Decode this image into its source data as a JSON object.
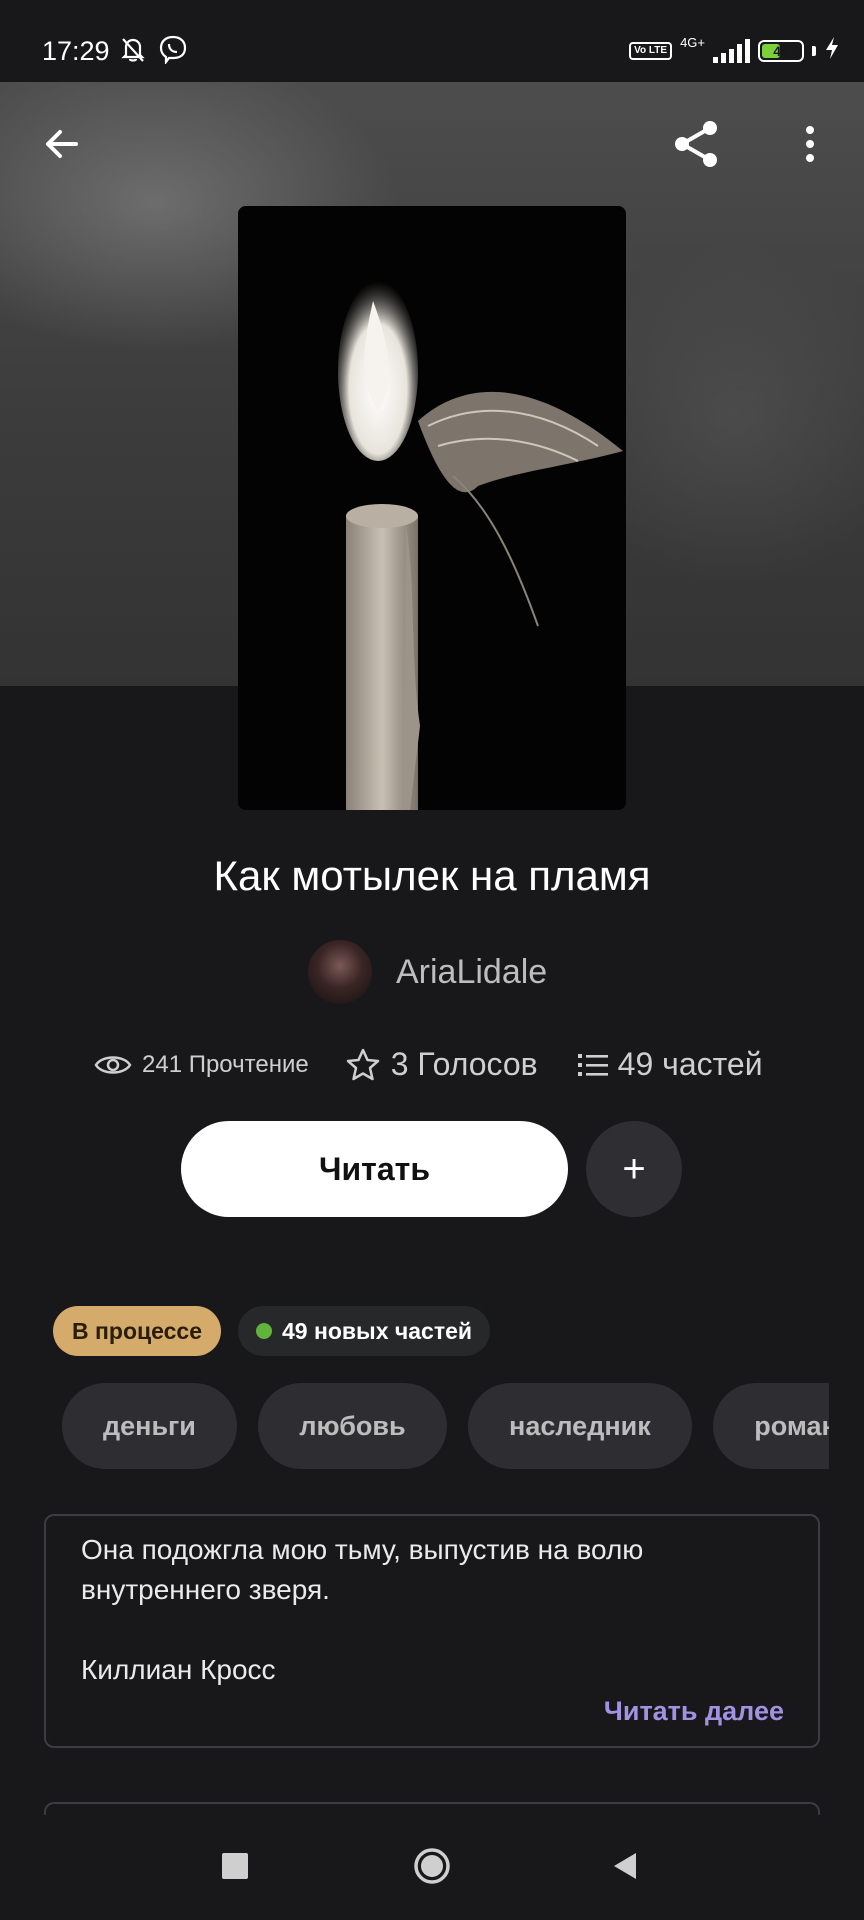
{
  "status_bar": {
    "time": "17:29",
    "network": "4G+",
    "volte": "Vo LTE",
    "battery": "46",
    "icons": [
      "mute-bell-icon",
      "viber-icon",
      "signal-icon",
      "battery-icon",
      "charging-icon"
    ]
  },
  "header": {
    "back_icon": "arrow-left-icon",
    "share_icon": "share-icon",
    "more_icon": "more-vertical-icon"
  },
  "story": {
    "title": "Как мотылек на пламя",
    "author": "AriaLidale",
    "stats": {
      "reads": "241 Прочтение",
      "votes": "3 Голосов",
      "parts": "49 частей"
    }
  },
  "actions": {
    "read_label": "Читать",
    "add_label": "+"
  },
  "badges": {
    "status": "В процессе",
    "new_parts": "49 новых частей"
  },
  "tags": [
    "деньги",
    "любовь",
    "наследник",
    "роман"
  ],
  "description": {
    "text": "Она подожгла мою тьму, выпустив на волю\nвнутреннего зверя.",
    "author_line": "Киллиан Кросс",
    "read_more": "Читать далее"
  },
  "colors": {
    "background": "#18171a",
    "accent_purple": "#a292e3",
    "badge_gold": "#d4ab6b",
    "green_dot": "#62b33c"
  }
}
